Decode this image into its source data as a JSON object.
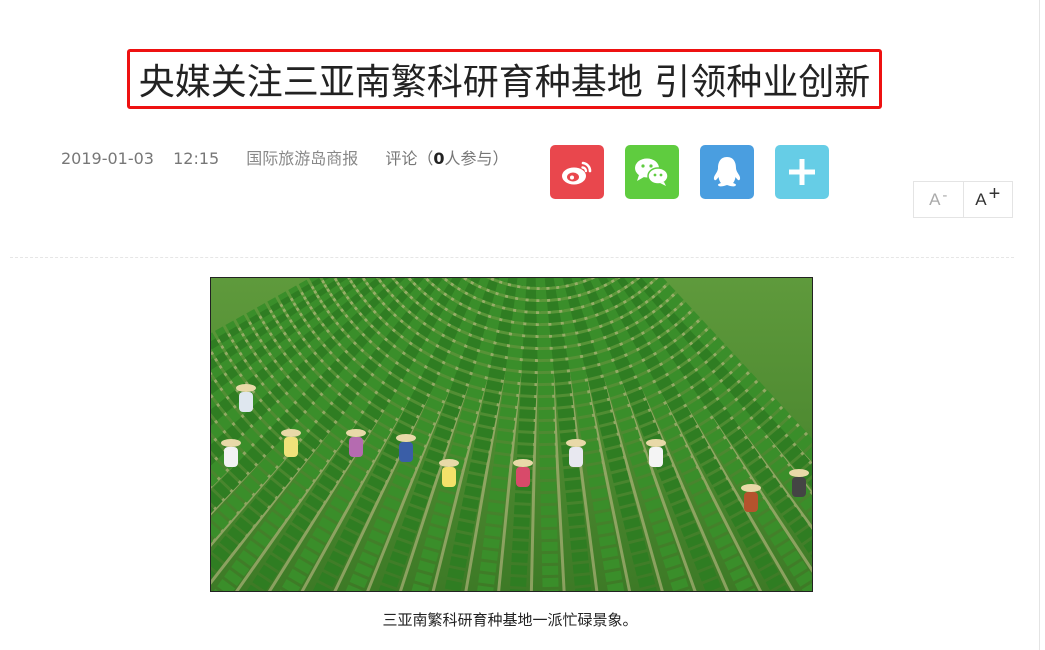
{
  "article": {
    "title": "央媒关注三亚南繁科研育种基地 引领种业创新",
    "date": "2019-01-03",
    "time": "12:15",
    "source": "国际旅游岛商报",
    "comment_prefix": "评论（",
    "comment_count": "0",
    "comment_suffix": "人参与）",
    "photo_caption": "三亚南繁科研育种基地一派忙碌景象。"
  },
  "share": [
    {
      "name": "weibo",
      "icon": "weibo-icon",
      "color": "#e9474d"
    },
    {
      "name": "wechat",
      "icon": "wechat-icon",
      "color": "#5fcc3f"
    },
    {
      "name": "qq",
      "icon": "qq-penguin-icon",
      "color": "#4a9ee0"
    },
    {
      "name": "more",
      "icon": "plus-icon",
      "color": "#66cde6"
    }
  ],
  "font_size": {
    "decrease_label": "A",
    "decrease_mark": "-",
    "increase_label": "A",
    "increase_mark": "+"
  },
  "colors": {
    "title_highlight": "#ee1111"
  }
}
